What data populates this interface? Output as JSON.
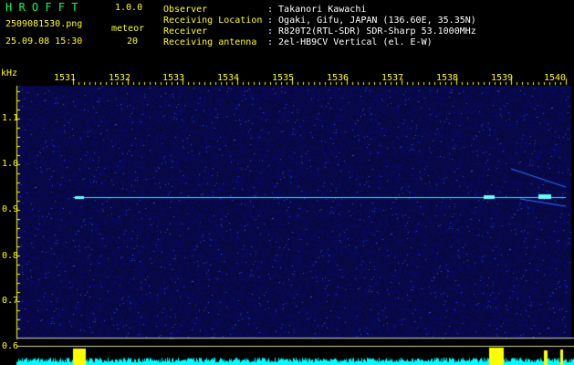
{
  "header": {
    "app_name": "H R O F F T",
    "version": "1.0.0",
    "filename": "2509081530.png",
    "timestamp": "25.09.08 15:30",
    "count_label": "meteor",
    "count_value": "20",
    "info_labels": [
      "Observer",
      "Receiving Location",
      "Receiver",
      "Receiving antenna"
    ],
    "info_values": [
      ": Takanori Kawachi",
      ": Ogaki, Gifu, JAPAN (136.60E, 35.35N)",
      ": R820T2(RTL-SDR) SDR-Sharp 53.1000MHz",
      ": 2el-HB9CV Vertical (el. E-W)"
    ]
  },
  "axes": {
    "y_unit": "kHz",
    "y_ticks": [
      "1.1",
      "1.0",
      "0.9",
      "0.8",
      "0.7",
      "0.6"
    ],
    "x_ticks": [
      "1531",
      "1532",
      "1533",
      "1534",
      "1535",
      "1536",
      "1537",
      "1538",
      "1539",
      "1540"
    ]
  },
  "colors": {
    "background": "#000000",
    "plot_background": "#0a0a3a",
    "title_green": "#00ff66",
    "label_yellow": "#ffff00",
    "text_white": "#ffffff",
    "signal_cyan": "#00ffff",
    "burst_yellow": "#ffff00"
  }
}
